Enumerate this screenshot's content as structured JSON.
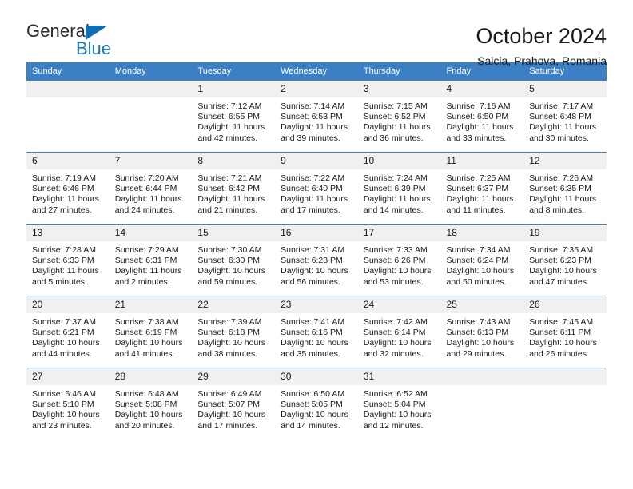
{
  "logo": {
    "word1": "General",
    "word2": "Blue",
    "triangle": "blue-triangle-icon",
    "accent": "#1c7ac0"
  },
  "header": {
    "title": "October 2024",
    "location": "Salcia, Prahova, Romania",
    "header_bg": "#3b7fc4"
  },
  "weekdays": [
    "Sunday",
    "Monday",
    "Tuesday",
    "Wednesday",
    "Thursday",
    "Friday",
    "Saturday"
  ],
  "labels": {
    "sunrise": "Sunrise:",
    "sunset": "Sunset:",
    "daylight": "Daylight:"
  },
  "weeks": [
    [
      {
        "day": "",
        "sunrise": "",
        "sunset": "",
        "daylight1": "",
        "daylight2": ""
      },
      {
        "day": "",
        "sunrise": "",
        "sunset": "",
        "daylight1": "",
        "daylight2": ""
      },
      {
        "day": "1",
        "sunrise": "Sunrise: 7:12 AM",
        "sunset": "Sunset: 6:55 PM",
        "daylight1": "Daylight: 11 hours",
        "daylight2": "and 42 minutes."
      },
      {
        "day": "2",
        "sunrise": "Sunrise: 7:14 AM",
        "sunset": "Sunset: 6:53 PM",
        "daylight1": "Daylight: 11 hours",
        "daylight2": "and 39 minutes."
      },
      {
        "day": "3",
        "sunrise": "Sunrise: 7:15 AM",
        "sunset": "Sunset: 6:52 PM",
        "daylight1": "Daylight: 11 hours",
        "daylight2": "and 36 minutes."
      },
      {
        "day": "4",
        "sunrise": "Sunrise: 7:16 AM",
        "sunset": "Sunset: 6:50 PM",
        "daylight1": "Daylight: 11 hours",
        "daylight2": "and 33 minutes."
      },
      {
        "day": "5",
        "sunrise": "Sunrise: 7:17 AM",
        "sunset": "Sunset: 6:48 PM",
        "daylight1": "Daylight: 11 hours",
        "daylight2": "and 30 minutes."
      }
    ],
    [
      {
        "day": "6",
        "sunrise": "Sunrise: 7:19 AM",
        "sunset": "Sunset: 6:46 PM",
        "daylight1": "Daylight: 11 hours",
        "daylight2": "and 27 minutes."
      },
      {
        "day": "7",
        "sunrise": "Sunrise: 7:20 AM",
        "sunset": "Sunset: 6:44 PM",
        "daylight1": "Daylight: 11 hours",
        "daylight2": "and 24 minutes."
      },
      {
        "day": "8",
        "sunrise": "Sunrise: 7:21 AM",
        "sunset": "Sunset: 6:42 PM",
        "daylight1": "Daylight: 11 hours",
        "daylight2": "and 21 minutes."
      },
      {
        "day": "9",
        "sunrise": "Sunrise: 7:22 AM",
        "sunset": "Sunset: 6:40 PM",
        "daylight1": "Daylight: 11 hours",
        "daylight2": "and 17 minutes."
      },
      {
        "day": "10",
        "sunrise": "Sunrise: 7:24 AM",
        "sunset": "Sunset: 6:39 PM",
        "daylight1": "Daylight: 11 hours",
        "daylight2": "and 14 minutes."
      },
      {
        "day": "11",
        "sunrise": "Sunrise: 7:25 AM",
        "sunset": "Sunset: 6:37 PM",
        "daylight1": "Daylight: 11 hours",
        "daylight2": "and 11 minutes."
      },
      {
        "day": "12",
        "sunrise": "Sunrise: 7:26 AM",
        "sunset": "Sunset: 6:35 PM",
        "daylight1": "Daylight: 11 hours",
        "daylight2": "and 8 minutes."
      }
    ],
    [
      {
        "day": "13",
        "sunrise": "Sunrise: 7:28 AM",
        "sunset": "Sunset: 6:33 PM",
        "daylight1": "Daylight: 11 hours",
        "daylight2": "and 5 minutes."
      },
      {
        "day": "14",
        "sunrise": "Sunrise: 7:29 AM",
        "sunset": "Sunset: 6:31 PM",
        "daylight1": "Daylight: 11 hours",
        "daylight2": "and 2 minutes."
      },
      {
        "day": "15",
        "sunrise": "Sunrise: 7:30 AM",
        "sunset": "Sunset: 6:30 PM",
        "daylight1": "Daylight: 10 hours",
        "daylight2": "and 59 minutes."
      },
      {
        "day": "16",
        "sunrise": "Sunrise: 7:31 AM",
        "sunset": "Sunset: 6:28 PM",
        "daylight1": "Daylight: 10 hours",
        "daylight2": "and 56 minutes."
      },
      {
        "day": "17",
        "sunrise": "Sunrise: 7:33 AM",
        "sunset": "Sunset: 6:26 PM",
        "daylight1": "Daylight: 10 hours",
        "daylight2": "and 53 minutes."
      },
      {
        "day": "18",
        "sunrise": "Sunrise: 7:34 AM",
        "sunset": "Sunset: 6:24 PM",
        "daylight1": "Daylight: 10 hours",
        "daylight2": "and 50 minutes."
      },
      {
        "day": "19",
        "sunrise": "Sunrise: 7:35 AM",
        "sunset": "Sunset: 6:23 PM",
        "daylight1": "Daylight: 10 hours",
        "daylight2": "and 47 minutes."
      }
    ],
    [
      {
        "day": "20",
        "sunrise": "Sunrise: 7:37 AM",
        "sunset": "Sunset: 6:21 PM",
        "daylight1": "Daylight: 10 hours",
        "daylight2": "and 44 minutes."
      },
      {
        "day": "21",
        "sunrise": "Sunrise: 7:38 AM",
        "sunset": "Sunset: 6:19 PM",
        "daylight1": "Daylight: 10 hours",
        "daylight2": "and 41 minutes."
      },
      {
        "day": "22",
        "sunrise": "Sunrise: 7:39 AM",
        "sunset": "Sunset: 6:18 PM",
        "daylight1": "Daylight: 10 hours",
        "daylight2": "and 38 minutes."
      },
      {
        "day": "23",
        "sunrise": "Sunrise: 7:41 AM",
        "sunset": "Sunset: 6:16 PM",
        "daylight1": "Daylight: 10 hours",
        "daylight2": "and 35 minutes."
      },
      {
        "day": "24",
        "sunrise": "Sunrise: 7:42 AM",
        "sunset": "Sunset: 6:14 PM",
        "daylight1": "Daylight: 10 hours",
        "daylight2": "and 32 minutes."
      },
      {
        "day": "25",
        "sunrise": "Sunrise: 7:43 AM",
        "sunset": "Sunset: 6:13 PM",
        "daylight1": "Daylight: 10 hours",
        "daylight2": "and 29 minutes."
      },
      {
        "day": "26",
        "sunrise": "Sunrise: 7:45 AM",
        "sunset": "Sunset: 6:11 PM",
        "daylight1": "Daylight: 10 hours",
        "daylight2": "and 26 minutes."
      }
    ],
    [
      {
        "day": "27",
        "sunrise": "Sunrise: 6:46 AM",
        "sunset": "Sunset: 5:10 PM",
        "daylight1": "Daylight: 10 hours",
        "daylight2": "and 23 minutes."
      },
      {
        "day": "28",
        "sunrise": "Sunrise: 6:48 AM",
        "sunset": "Sunset: 5:08 PM",
        "daylight1": "Daylight: 10 hours",
        "daylight2": "and 20 minutes."
      },
      {
        "day": "29",
        "sunrise": "Sunrise: 6:49 AM",
        "sunset": "Sunset: 5:07 PM",
        "daylight1": "Daylight: 10 hours",
        "daylight2": "and 17 minutes."
      },
      {
        "day": "30",
        "sunrise": "Sunrise: 6:50 AM",
        "sunset": "Sunset: 5:05 PM",
        "daylight1": "Daylight: 10 hours",
        "daylight2": "and 14 minutes."
      },
      {
        "day": "31",
        "sunrise": "Sunrise: 6:52 AM",
        "sunset": "Sunset: 5:04 PM",
        "daylight1": "Daylight: 10 hours",
        "daylight2": "and 12 minutes."
      },
      {
        "day": "",
        "sunrise": "",
        "sunset": "",
        "daylight1": "",
        "daylight2": ""
      },
      {
        "day": "",
        "sunrise": "",
        "sunset": "",
        "daylight1": "",
        "daylight2": ""
      }
    ]
  ]
}
